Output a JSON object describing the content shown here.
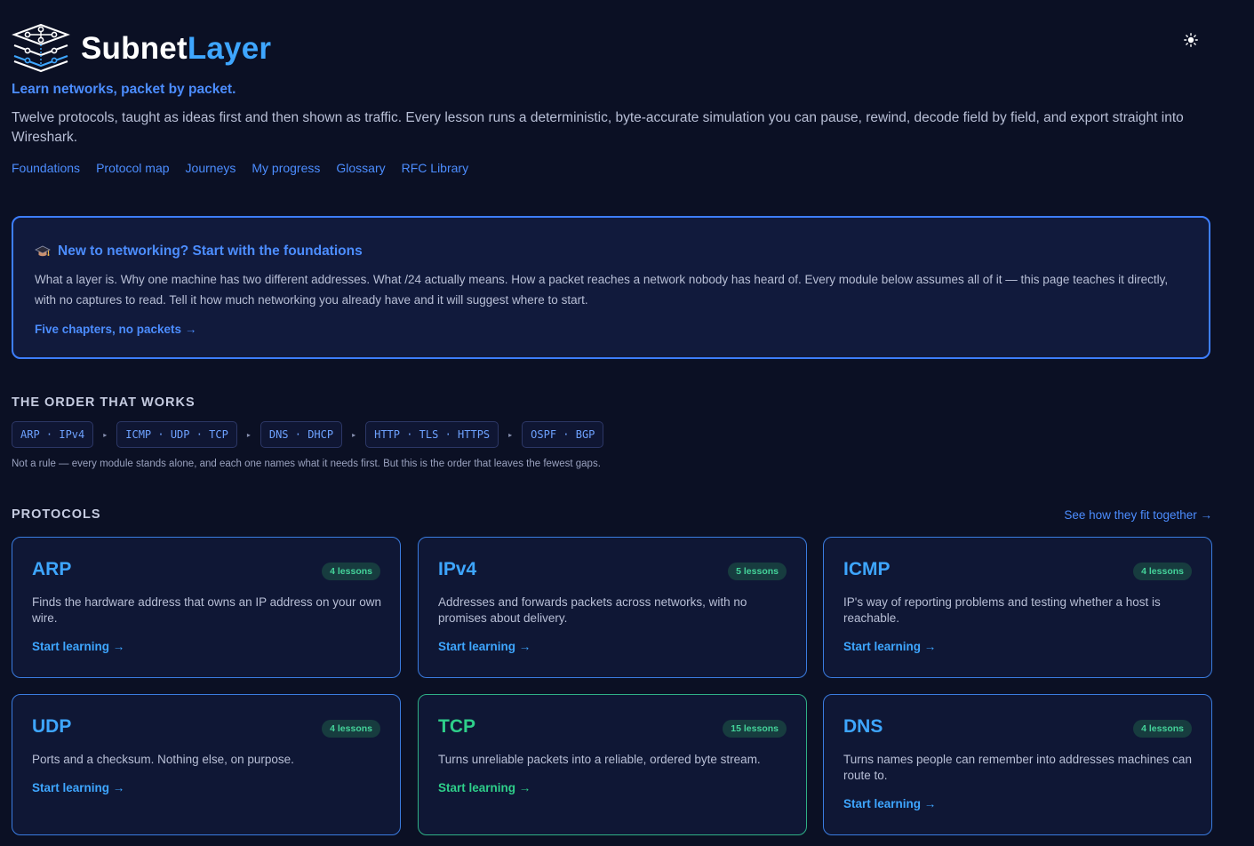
{
  "brand": {
    "name_part1": "Subnet",
    "name_part2": "Layer"
  },
  "header": {
    "tagline": "Learn networks, packet by packet.",
    "intro": "Twelve protocols, taught as ideas first and then shown as traffic. Every lesson runs a deterministic, byte-accurate simulation you can pause, rewind, decode field by field, and export straight into Wireshark."
  },
  "nav": [
    "Foundations",
    "Protocol map",
    "Journeys",
    "My progress",
    "Glossary",
    "RFC Library"
  ],
  "callout": {
    "title": "New to networking? Start with the foundations",
    "body": "What a layer is. Why one machine has two different addresses. What /24 actually means. How a packet reaches a network nobody has heard of. Every module below assumes all of it — this page teaches it directly, with no captures to read. Tell it how much networking you already have and it will suggest where to start.",
    "link": "Five chapters, no packets →"
  },
  "order": {
    "heading": "THE ORDER THAT WORKS",
    "steps": [
      "ARP · IPv4",
      "ICMP · UDP · TCP",
      "DNS · DHCP",
      "HTTP · TLS · HTTPS",
      "OSPF · BGP"
    ],
    "separator": "▸",
    "note": "Not a rule — every module stands alone, and each one names what it needs first. But this is the order that leaves the fewest gaps."
  },
  "protocols": {
    "heading": "PROTOCOLS",
    "see_link": "See how they fit together →",
    "cards": [
      {
        "name": "ARP",
        "lessons": "4 lessons",
        "desc": "Finds the hardware address that owns an IP address on your own wire.",
        "cta": "Start learning →"
      },
      {
        "name": "IPv4",
        "lessons": "5 lessons",
        "desc": "Addresses and forwards packets across networks, with no promises about delivery.",
        "cta": "Start learning →"
      },
      {
        "name": "ICMP",
        "lessons": "4 lessons",
        "desc": "IP's way of reporting problems and testing whether a host is reachable.",
        "cta": "Start learning →"
      },
      {
        "name": "UDP",
        "lessons": "4 lessons",
        "desc": "Ports and a checksum. Nothing else, on purpose.",
        "cta": "Start learning →"
      },
      {
        "name": "TCP",
        "lessons": "15 lessons",
        "desc": "Turns unreliable packets into a reliable, ordered byte stream.",
        "cta": "Start learning →"
      },
      {
        "name": "DNS",
        "lessons": "4 lessons",
        "desc": "Turns names people can remember into addresses machines can route to.",
        "cta": "Start learning →"
      }
    ]
  },
  "colors": {
    "background": "#0b1024",
    "accent_blue": "#4c8dff",
    "card_blue": "#3ea6ff",
    "card_green": "#2ecf8a"
  },
  "icons": {
    "logo": "layered-network-icon",
    "theme": "sun-icon",
    "callout": "graduation-cap-icon"
  }
}
